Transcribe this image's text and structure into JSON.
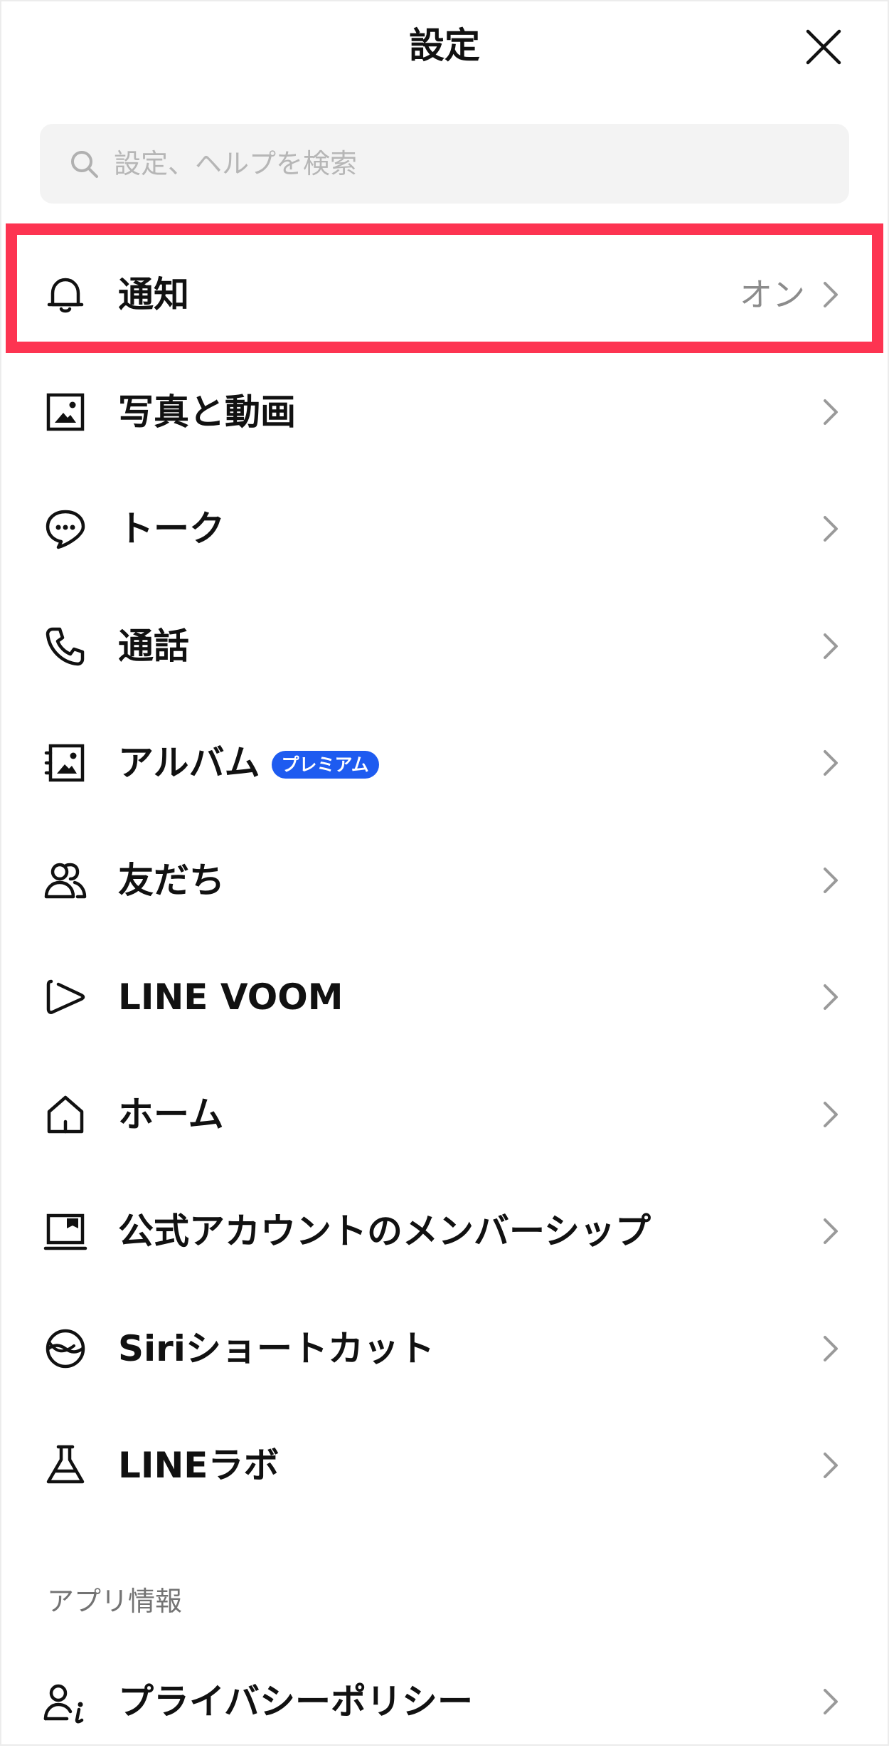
{
  "header": {
    "title": "設定",
    "close_icon": "close-icon"
  },
  "search": {
    "placeholder": "設定、ヘルプを検索",
    "value": "",
    "icon": "search-icon"
  },
  "colors": {
    "highlight": "#fd3451",
    "badge": "#1e5bf0",
    "secondary_text": "#8c8c8c",
    "search_bg": "#f3f3f3"
  },
  "settings_items": [
    {
      "label": "通知",
      "value": "オン",
      "icon": "bell-icon",
      "highlighted": true
    },
    {
      "label": "写真と動画",
      "icon": "photo-icon"
    },
    {
      "label": "トーク",
      "icon": "chat-bubble-icon"
    },
    {
      "label": "通話",
      "icon": "phone-icon"
    },
    {
      "label": "アルバム",
      "badge": "プレミアム",
      "icon": "album-icon"
    },
    {
      "label": "友だち",
      "icon": "friends-icon"
    },
    {
      "label": "LINE VOOM",
      "icon": "voom-play-icon"
    },
    {
      "label": "ホーム",
      "icon": "home-icon"
    },
    {
      "label": "公式アカウントのメンバーシップ",
      "icon": "membership-card-icon"
    },
    {
      "label": "Siriショートカット",
      "icon": "siri-icon"
    },
    {
      "label": "LINEラボ",
      "icon": "flask-icon"
    }
  ],
  "app_info": {
    "section_title": "アプリ情報",
    "items": [
      {
        "label": "プライバシーポリシー",
        "icon": "privacy-icon"
      }
    ]
  }
}
